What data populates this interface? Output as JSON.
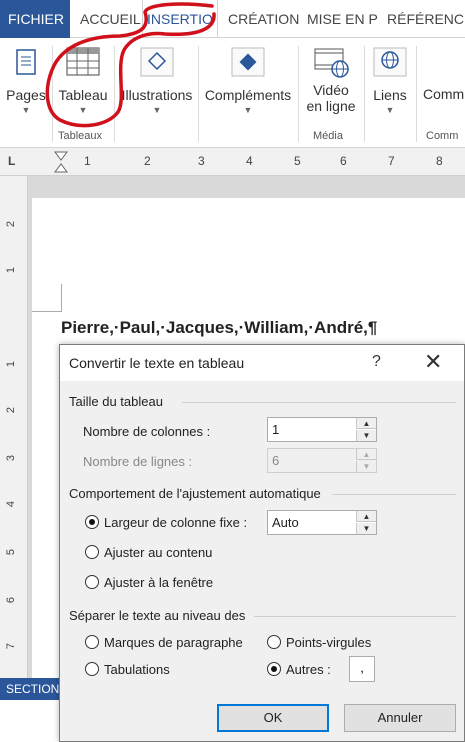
{
  "ribbon_tabs": {
    "file": "FICHIER",
    "home": "ACCUEIL",
    "insert": "INSERTIO",
    "design": "CRÉATION",
    "layout": "MISE EN P",
    "references": "RÉFÉRENC"
  },
  "ribbon": {
    "pages": "Pages",
    "table": "Tableau",
    "illustrations": "Illustrations",
    "addins": "Compléments",
    "video_line1": "Vidéo",
    "video_line2": "en ligne",
    "links": "Liens",
    "comments_partial": "Comm",
    "group_tables": "Tableaux",
    "group_media": "Média",
    "group_comments_partial": "Comm"
  },
  "ruler": {
    "marks": [
      "L",
      "1",
      "2",
      "3",
      "4",
      "5",
      "6",
      "7",
      "8"
    ]
  },
  "vertical_ruler": {
    "marks": [
      "2",
      "1",
      "1",
      "2",
      "3",
      "4",
      "5",
      "6",
      "7"
    ]
  },
  "document": {
    "text": "Pierre,·Paul,·Jacques,·William,·André,¶"
  },
  "status_bar": {
    "section": "SECTION"
  },
  "dialog": {
    "title": "Convertir le texte en tableau",
    "help": "?",
    "close": "✕",
    "size_section": "Taille du tableau",
    "columns_label": "Nombre de colonnes :",
    "columns_value": "1",
    "rows_label": "Nombre de lignes :",
    "rows_value": "6",
    "autofit_section": "Comportement de l'ajustement automatique",
    "fixed_width_label": "Largeur de colonne fixe :",
    "fixed_width_value": "Auto",
    "fixed_width_selected": true,
    "fit_content_label": "Ajuster au contenu",
    "fit_window_label": "Ajuster à la fenêtre",
    "separator_section": "Séparer le texte au niveau des",
    "paragraphs_label": "Marques de paragraphe",
    "semicolons_label": "Points-virgules",
    "tabs_label": "Tabulations",
    "other_label": "Autres :",
    "other_selected": true,
    "other_value": ",",
    "ok": "OK",
    "cancel": "Annuler"
  },
  "colors": {
    "accent": "#2b579a",
    "annotation": "#d0101a",
    "focus": "#0078d7"
  }
}
